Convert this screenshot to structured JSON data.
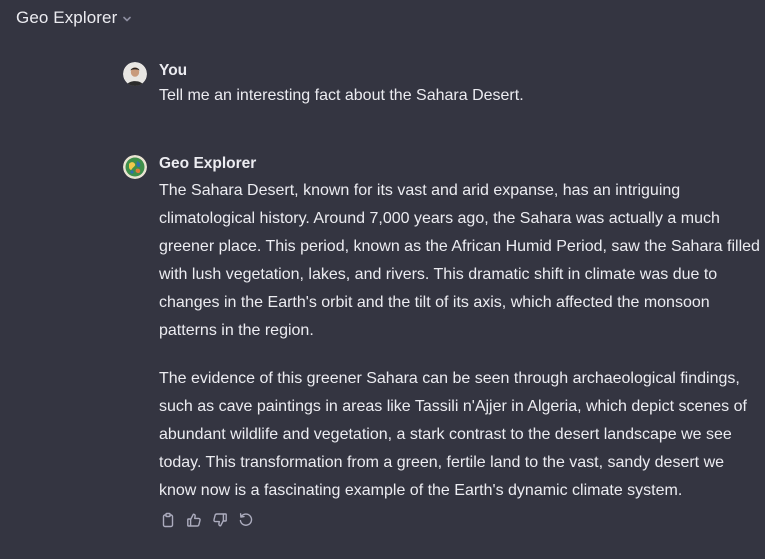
{
  "header": {
    "title": "Geo Explorer",
    "chevron_icon": "chevron-down-icon"
  },
  "user_message": {
    "author": "You",
    "text": "Tell me an interesting fact about the Sahara Desert."
  },
  "assistant_message": {
    "author": "Geo Explorer",
    "paragraph1_lines": [
      "The Sahara Desert, known for its vast and arid expanse, has an intriguing",
      "climatological history. Around 7,000 years ago, the Sahara was actually a much",
      "greener place. This period, known as the African Humid Period, saw the Sahara filled",
      "with lush vegetation, lakes, and rivers. This dramatic shift in climate was due to",
      "changes in the Earth's orbit and the tilt of its axis, which affected the monsoon",
      "patterns in the region."
    ],
    "paragraph2_lines": [
      "The evidence of this greener Sahara can be seen through archaeological findings,",
      "such as cave paintings in areas like Tassili n'Ajjer in Algeria, which depict scenes of",
      "abundant wildlife and vegetation, a stark contrast to the desert landscape we see",
      "today. This transformation from a green, fertile land to the vast, sandy desert we",
      "know now is a fascinating example of the Earth's dynamic climate system."
    ]
  },
  "actions": [
    "copy-icon",
    "thumbs-up-icon",
    "thumbs-down-icon",
    "regenerate-icon"
  ],
  "colors": {
    "background": "#343541",
    "text": "#ececf1",
    "icon": "#acacbe"
  }
}
